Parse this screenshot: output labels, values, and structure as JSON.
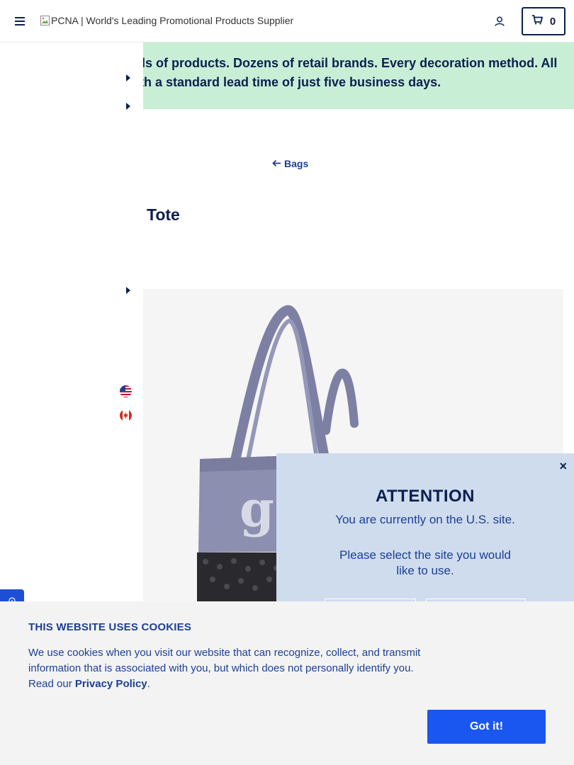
{
  "header": {
    "logo_alt": "PCNA | World's Leading Promotional Products Supplier",
    "cart_count": "0"
  },
  "banner": {
    "line1": "ls of products. Dozens of retail brands. Every decoration method. All",
    "line2": "th a standard lead time of just five business days."
  },
  "breadcrumb": {
    "label": "Bags"
  },
  "product": {
    "title_fragment": "Tote"
  },
  "modal": {
    "title": "ATTENTION",
    "current_site": "You are currently on the U.S. site.",
    "prompt": "Please select the site you would like to use.",
    "close": "×"
  },
  "cookie": {
    "title": "THIS WEBSITE USES COOKIES",
    "text": "We use cookies when you visit our website that can recognize, collect, and transmit information that is associated with you, but which does not personally identify you. Read our",
    "link": "Privacy Policy",
    "period": ".",
    "button": "Got it!"
  },
  "icons": {
    "menu": "hamburger-icon",
    "account": "user-icon",
    "cart": "cart-icon",
    "flag_us": "us-flag-icon",
    "flag_ca": "canada-flag-icon"
  },
  "colors": {
    "navy": "#0d1f4f",
    "link_blue": "#1c3f94",
    "banner_green": "#c8efd6",
    "modal_bg": "#cfdcee",
    "button_blue": "#1a56f0"
  }
}
